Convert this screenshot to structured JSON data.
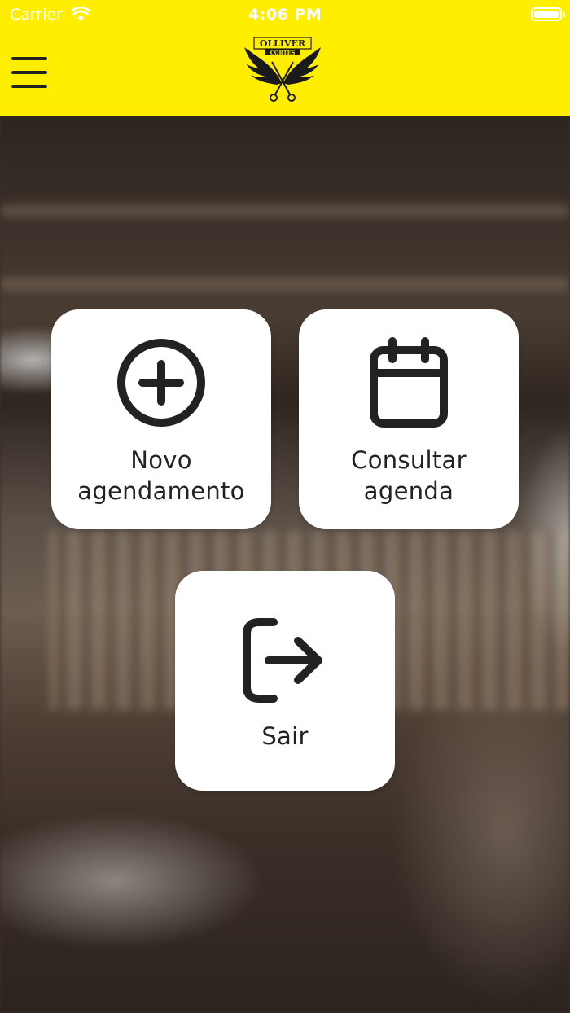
{
  "status_bar": {
    "carrier": "Carrier",
    "time": "4:06 PM"
  },
  "header": {
    "logo_top_text": "OLLIVER",
    "logo_bottom_text": "CORTES",
    "brand_color": "#ffee00"
  },
  "actions": [
    {
      "label_line1": "Novo",
      "label_line2": "agendamento",
      "icon": "plus-circle-icon"
    },
    {
      "label_line1": "Consultar",
      "label_line2": "agenda",
      "icon": "calendar-icon"
    },
    {
      "label": "Sair",
      "icon": "logout-icon"
    }
  ]
}
